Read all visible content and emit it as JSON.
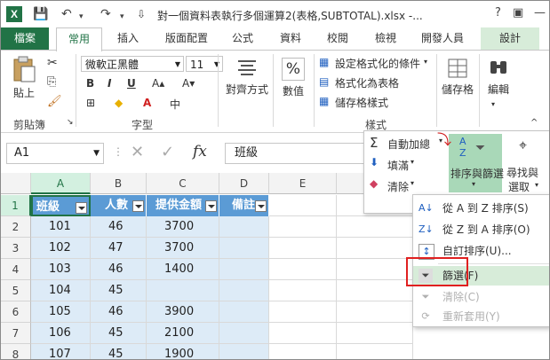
{
  "window": {
    "title": "對一個資料表執行多個運算2(表格,SUBTOTAL).xlsx -...",
    "app_icon": "X",
    "quick_access": {
      "save": "💾",
      "undo": "↶",
      "redo": "↷",
      "customize": "⇩"
    }
  },
  "tabs": {
    "file": "檔案",
    "home": "常用",
    "insert": "插入",
    "layout": "版面配置",
    "formulas": "公式",
    "data": "資料",
    "review": "校閱",
    "view": "檢視",
    "developer": "開發人員",
    "design": "設計"
  },
  "ribbon": {
    "clipboard": {
      "paste": "貼上",
      "label": "剪貼簿"
    },
    "font": {
      "name": "微軟正黑體",
      "size": "11",
      "bold": "B",
      "italic": "I",
      "underline": "U",
      "label": "字型"
    },
    "alignment": {
      "label": "對齊方式"
    },
    "number": {
      "label": "數值",
      "percent": "%"
    },
    "styles": {
      "conditional": "設定格式化的條件",
      "table": "格式化為表格",
      "cell": "儲存格樣式",
      "label": "樣式"
    },
    "cells": {
      "label": "儲存格"
    },
    "editing": {
      "label": "編輯"
    }
  },
  "editing_panel": {
    "autosum": "自動加總",
    "fill": "填滿",
    "clear": "清除",
    "sort_filter": "排序與篩選",
    "find_select_1": "尋找與",
    "find_select_2": "選取"
  },
  "sort_menu": {
    "items": [
      {
        "label": "從 A 到 Z 排序(S)",
        "disabled": false
      },
      {
        "label": "從 Z 到 A 排序(O)",
        "disabled": false
      },
      {
        "label": "自訂排序(U)...",
        "disabled": false
      },
      {
        "label": "篩選(F)",
        "disabled": false,
        "highlighted": true
      },
      {
        "label": "清除(C)",
        "disabled": true
      },
      {
        "label": "重新套用(Y)",
        "disabled": true
      }
    ]
  },
  "formula_bar": {
    "name_box": "A1",
    "fx": "fx",
    "content": "班級"
  },
  "sheet": {
    "columns": [
      "A",
      "B",
      "C",
      "D",
      "E"
    ],
    "rows": [
      "1",
      "2",
      "3",
      "4",
      "5",
      "6",
      "7",
      "8"
    ],
    "header": [
      "班級",
      "人數",
      "提供金額",
      "備註"
    ],
    "data": [
      [
        "101",
        "46",
        "3700"
      ],
      [
        "102",
        "47",
        "3700"
      ],
      [
        "103",
        "46",
        "1400"
      ],
      [
        "104",
        "45",
        ""
      ],
      [
        "105",
        "46",
        "3900"
      ],
      [
        "106",
        "45",
        "2100"
      ],
      [
        "107",
        "45",
        "1900"
      ]
    ]
  }
}
